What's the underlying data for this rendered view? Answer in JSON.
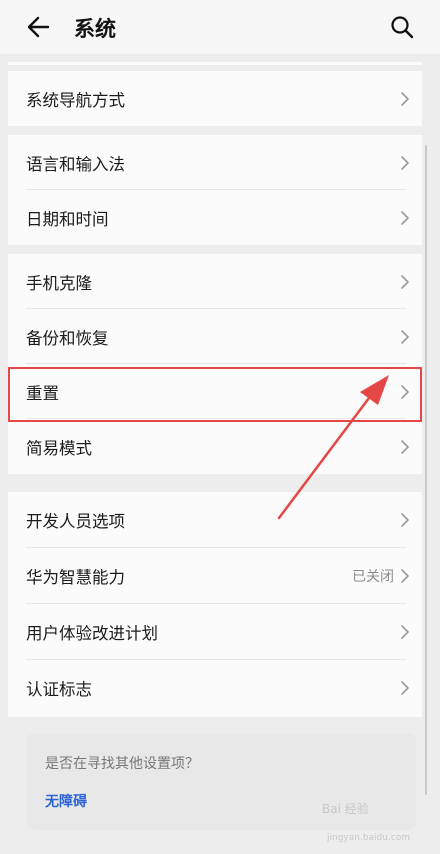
{
  "header": {
    "title": "系统"
  },
  "groups": [
    {
      "items": [
        {
          "label": "系统导航方式"
        }
      ]
    },
    {
      "items": [
        {
          "label": "语言和输入法"
        },
        {
          "label": "日期和时间"
        }
      ]
    },
    {
      "items": [
        {
          "label": "手机克隆"
        },
        {
          "label": "备份和恢复"
        },
        {
          "label": "重置"
        },
        {
          "label": "简易模式"
        }
      ]
    },
    {
      "items": [
        {
          "label": "开发人员选项"
        },
        {
          "label": "华为智慧能力",
          "value": "已关闭"
        },
        {
          "label": "用户体验改进计划"
        },
        {
          "label": "认证标志"
        }
      ]
    }
  ],
  "suggestion": {
    "question": "是否在寻找其他设置项？",
    "link": "无障碍"
  },
  "watermark": {
    "text": "Bai 经验",
    "url": "jingyan.baidu.com"
  },
  "colors": {
    "highlight": "#e54646",
    "link": "#2e64d6",
    "background": "#ededed",
    "card": "#fbfbfb"
  },
  "icons": {
    "back": "arrow-left-icon",
    "search": "search-icon",
    "chevron": "chevron-right-icon"
  }
}
